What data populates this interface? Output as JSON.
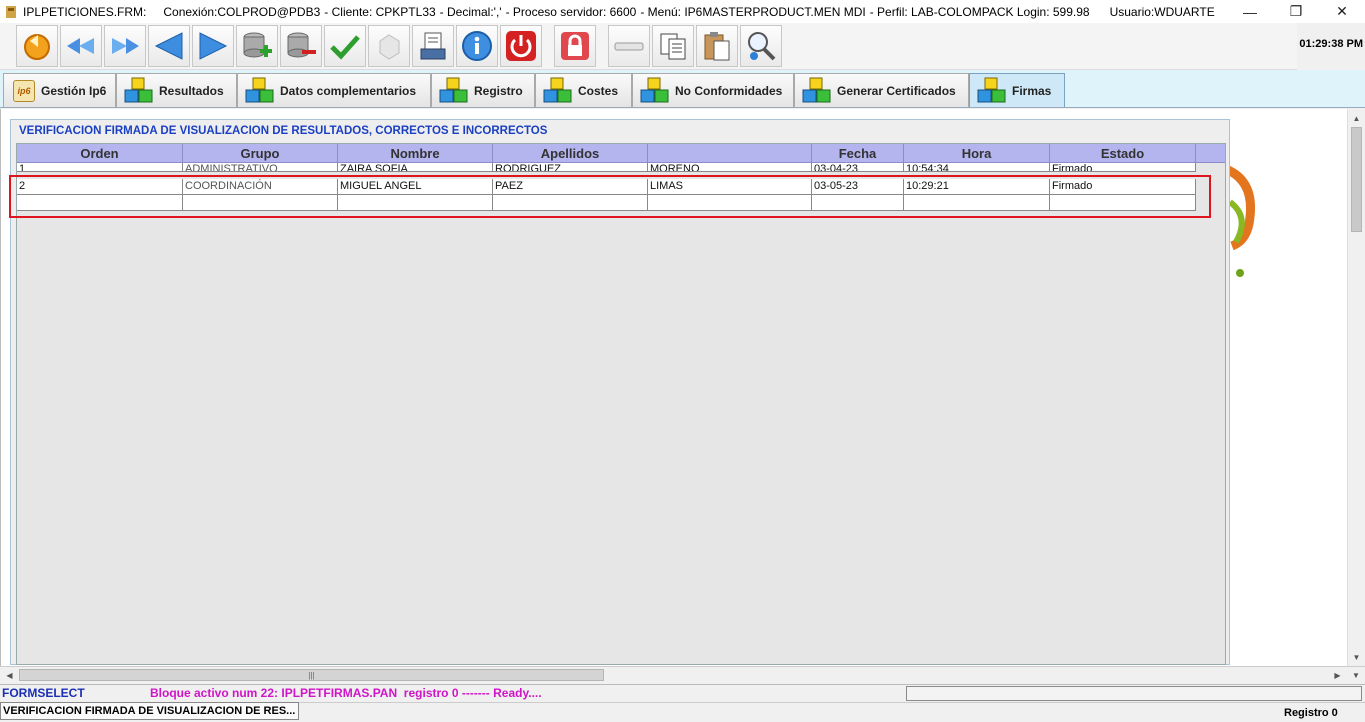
{
  "titlebar": {
    "form": "IPLPETICIONES.FRM:",
    "connection": "Conexión:COLPROD@PDB3",
    "client": "- Cliente: CPKPTL33",
    "decimal": "- Decimal:','",
    "process": "- Proceso servidor: 6600",
    "menu": "- Menú: IP6MASTERPRODUCT.MEN MDI",
    "profile": "- Perfil: LAB-COLOMPACK Login: 599.98",
    "user": "Usuario:WDUARTE",
    "minimize": "—",
    "restore": "❐",
    "close": "✕"
  },
  "toolbar": {
    "buttons": [
      "undo",
      "first-record",
      "last-record",
      "previous",
      "next",
      "insert-record",
      "delete-record",
      "accept",
      "clear",
      "print",
      "info",
      "exit",
      "lock",
      "blank",
      "copy",
      "paste",
      "find"
    ],
    "clock": "01:29:38 PM"
  },
  "tabs": [
    {
      "label": "Gestión Ip6",
      "logo": "ip6"
    },
    {
      "label": "Resultados"
    },
    {
      "label": "Datos complementarios"
    },
    {
      "label": "Registro"
    },
    {
      "label": "Costes"
    },
    {
      "label": "No Conformidades"
    },
    {
      "label": "Generar Certificados"
    },
    {
      "label": "Firmas",
      "active": true
    }
  ],
  "panel": {
    "title": "VERIFICACION FIRMADA DE VISUALIZACION DE RESULTADOS, CORRECTOS E INCORRECTOS"
  },
  "grid": {
    "headers": [
      "Orden",
      "Grupo",
      "Nombre",
      "Apellidos",
      "",
      "Fecha",
      "Hora",
      "Estado"
    ],
    "rows": [
      [
        "1",
        "ADMINISTRATIVO",
        "ZAIRA SOFIA",
        "RODRIGUEZ",
        "MORENO",
        "03-04-23",
        "10:54:34",
        "Firmado"
      ],
      [
        "2",
        "COORDINACIÓN",
        "MIGUEL ANGEL",
        "PAEZ",
        "LIMAS",
        "03-05-23",
        "10:29:21",
        "Firmado"
      ],
      [
        "",
        "",
        "",
        "",
        "",
        "",
        "",
        ""
      ]
    ]
  },
  "hscroll": {
    "thumb_grip": "|||"
  },
  "status": {
    "form": "FORMSELECT",
    "message": "Bloque activo num 22: IPLPETFIRMAS.PAN  registro 0 ------- Ready....",
    "window_caption": "VERIFICACION FIRMADA DE VISUALIZACION DE RES...",
    "record": "Registro 0"
  },
  "colors": {
    "header_bg": "#b4b4ef",
    "panel_title": "#1b3fc2",
    "status_form": "#1b2fb3",
    "status_message": "#d015c8",
    "highlight": "#e0141e",
    "active_tab": "#cfe8f7"
  }
}
